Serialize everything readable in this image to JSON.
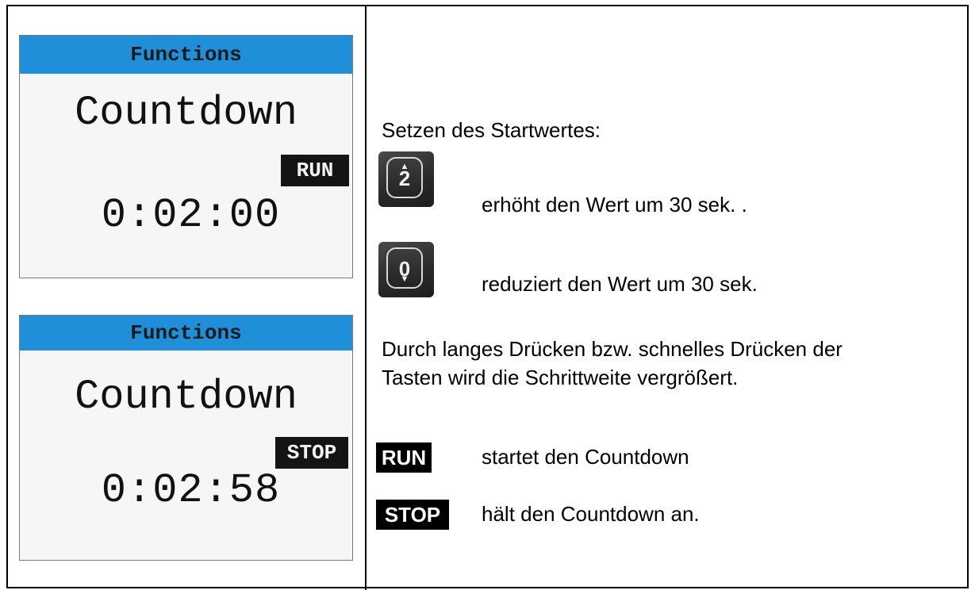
{
  "left_panel": {
    "screen_1": {
      "header": "Functions",
      "title": "Countdown",
      "badge": "RUN",
      "time": "0:02:00"
    },
    "screen_2": {
      "header": "Functions",
      "title": "Countdown",
      "badge": "STOP",
      "time": "0:02:58"
    }
  },
  "right_panel": {
    "heading": "Setzen des Startwertes:",
    "key_up": {
      "label": "2",
      "icon": "arrow-up-icon"
    },
    "key_up_desc": "erhöht den Wert um 30 sek. .",
    "key_down": {
      "label": "0",
      "icon": "arrow-down-icon"
    },
    "key_down_desc": "reduziert den Wert um 30 sek.",
    "paragraph_line_1": "Durch langes Drücken bzw. schnelles Drücken der",
    "paragraph_line_2": "Tasten wird die Schrittweite vergrößert.",
    "run_badge": "RUN",
    "run_desc": "startet den Countdown",
    "stop_badge": "STOP",
    "stop_desc": "hält den Countdown an."
  },
  "colors": {
    "screen_header": "#1e8fd8",
    "screen_background": "#f6f6f6",
    "badge_background": "#000000"
  }
}
